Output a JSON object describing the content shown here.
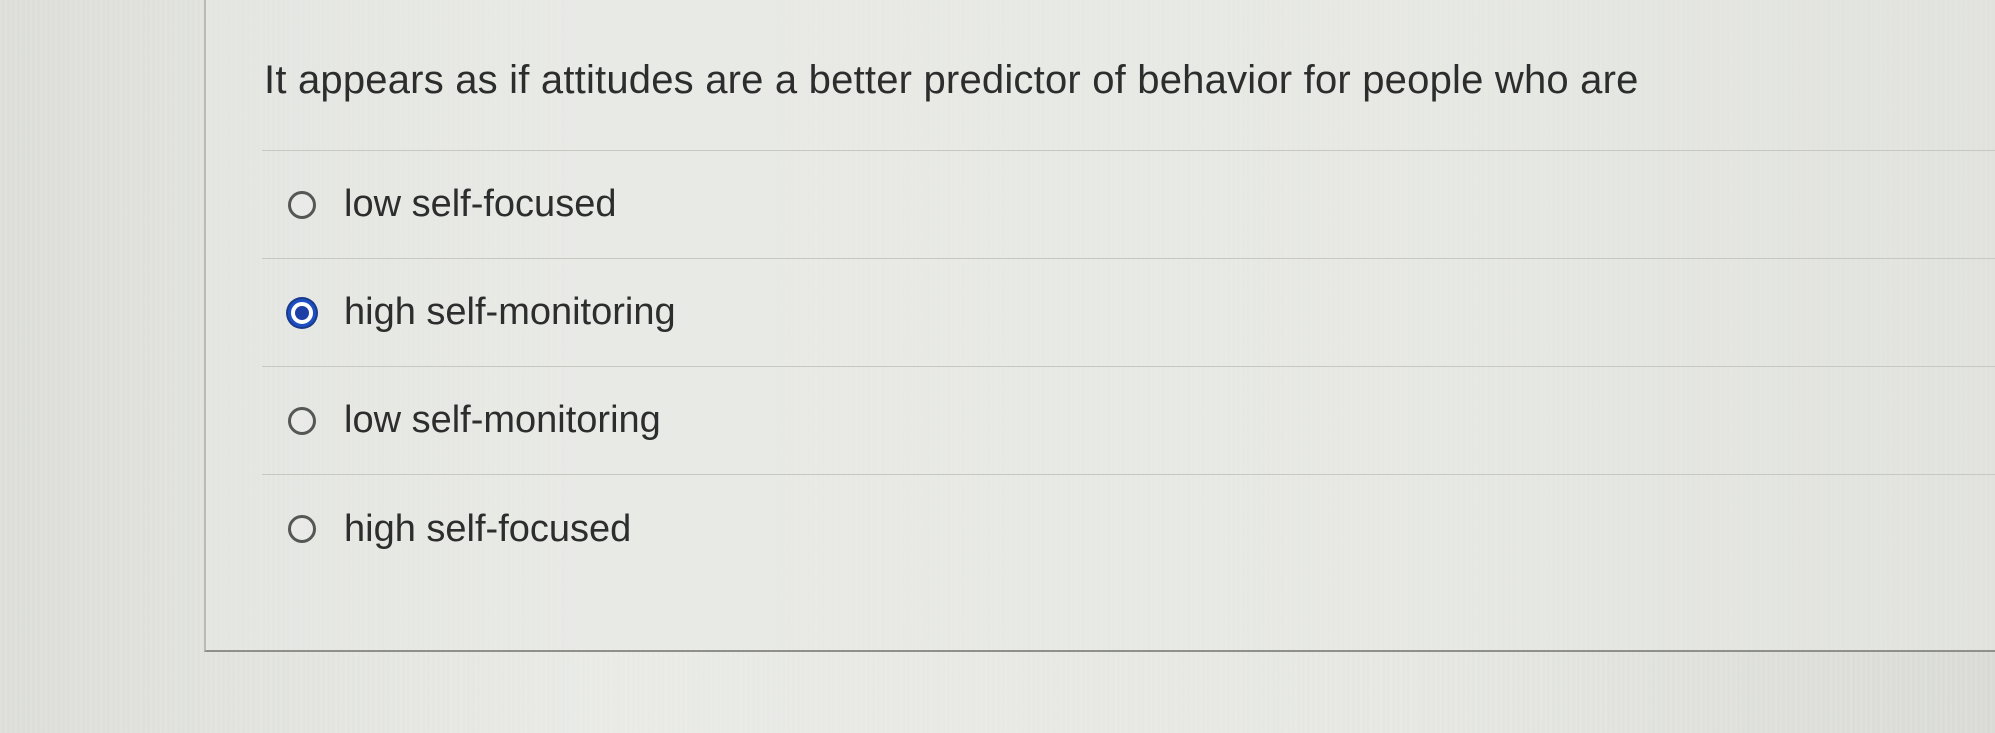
{
  "question": {
    "text": "It appears as if attitudes are a better predictor of behavior for people who are"
  },
  "options": [
    {
      "label": "low self-focused",
      "selected": false
    },
    {
      "label": "high self-monitoring",
      "selected": true
    },
    {
      "label": "low self-monitoring",
      "selected": false
    },
    {
      "label": "high self-focused",
      "selected": false
    }
  ],
  "colors": {
    "selected_radio": "#1e3fa6",
    "text": "#2c2d2c"
  }
}
